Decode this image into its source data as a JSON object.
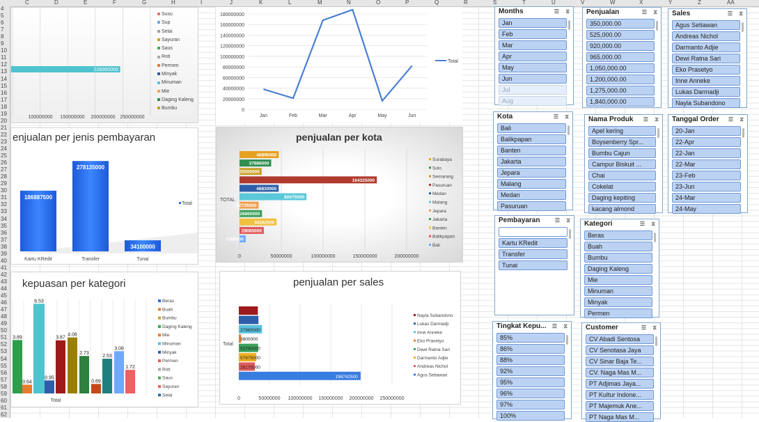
{
  "sheet": {
    "columns": [
      "C",
      "D",
      "E",
      "F",
      "G",
      "H",
      "I",
      "J",
      "K",
      "L",
      "M",
      "N",
      "O",
      "P",
      "Q",
      "R",
      "S",
      "T",
      "U",
      "V",
      "W",
      "X",
      "Y",
      "Z",
      "AA"
    ],
    "rows": [
      "4",
      "5",
      "6",
      "7",
      "8",
      "9",
      "10",
      "11",
      "12",
      "13",
      "14",
      "15",
      "16",
      "17",
      "18",
      "19",
      "20",
      "21",
      "22",
      "23",
      "24",
      "25",
      "26",
      "27",
      "28",
      "29",
      "30",
      "31",
      "32",
      "33",
      "34",
      "35",
      "36",
      "37",
      "38",
      "39",
      "40",
      "41",
      "42",
      "43",
      "44",
      "45",
      "46",
      "47",
      "48",
      "49",
      "50",
      "51",
      "52",
      "53",
      "54",
      "55",
      "56",
      "57",
      "58",
      "59",
      "60",
      "61",
      "62"
    ]
  },
  "chart_data": [
    {
      "type": "bar",
      "title": "",
      "legend": [
        "Susu",
        "Sup",
        "Selai",
        "Sayuran",
        "Saus",
        "Roti",
        "Permen",
        "Minyak",
        "Minuman",
        "Mie",
        "Daging Kaleng",
        "Bumbu"
      ],
      "series": [
        {
          "values": [
            228360000
          ]
        }
      ],
      "x_ticks": [
        "100000000",
        "150000000",
        "200000000",
        "250000000"
      ],
      "colors": [
        "#e8756a",
        "#6fa8dc",
        "#a0a0a0",
        "#c9a227",
        "#4aa85a",
        "#aaaaaa",
        "#e87c2e",
        "#2e5ea8",
        "#5bc0de",
        "#f0a050",
        "#2f8f4f",
        "#c9a227"
      ]
    },
    {
      "type": "line",
      "title": "",
      "categories": [
        "Jan",
        "Feb",
        "Mar",
        "Apr",
        "May",
        "Jun"
      ],
      "series": [
        {
          "name": "Total",
          "values": [
            38000000,
            21000000,
            168000000,
            188000000,
            16000000,
            82000000
          ]
        }
      ],
      "y_ticks": [
        "0",
        "20000000",
        "40000000",
        "60000000",
        "80000000",
        "100000000",
        "120000000",
        "140000000",
        "160000000",
        "180000000"
      ],
      "ylim": [
        0,
        180000000
      ],
      "color": "#4a7fd4"
    },
    {
      "type": "bar",
      "title": "enjualan per jenis pembayaran",
      "categories": [
        "Kartu KRedit",
        "Transfer",
        "Tunai"
      ],
      "series": [
        {
          "name": "Total",
          "values": [
            186887500,
            278135000,
            34100000
          ]
        }
      ],
      "value_labels": [
        "186887500",
        "278135000",
        "34100000"
      ],
      "color": "#2d6fe6"
    },
    {
      "type": "bar",
      "title": "penjualan per kota",
      "categories": [
        "Surabaya",
        "Solo",
        "Semarang",
        "Pasuruan",
        "Medan",
        "Malang",
        "Jepara",
        "Jakarta",
        "Banten",
        "Balikpapan",
        "Bali"
      ],
      "values": [
        46890000,
        37886000,
        26500000,
        164325000,
        46830000,
        80075000,
        22726000,
        26860000,
        44262500,
        29065000,
        7386000
      ],
      "value_labels": [
        "46890000",
        "37886000",
        "26500000",
        "164325000",
        "46830000",
        "80075000",
        "22726000",
        "26860000",
        "44262500",
        "29065000",
        "7386000"
      ],
      "axis_label": "TOTAL",
      "x_ticks": [
        "0",
        "50000000",
        "100000000",
        "150000000",
        "200000000"
      ],
      "xlim": [
        0,
        200000000
      ],
      "colors": [
        "#e8a020",
        "#2f8f4f",
        "#c9a227",
        "#b03a2e",
        "#2e5ea8",
        "#5bc8d8",
        "#f0a050",
        "#3aa05a",
        "#f0c040",
        "#e05a5a",
        "#6fa8ff"
      ]
    },
    {
      "type": "bar",
      "title": "kepuasan per kategori",
      "axis_label": "Total",
      "legend": [
        "Beras",
        "Buah",
        "Bumbu",
        "Daging Kaleng",
        "Mie",
        "Minuman",
        "Minyak",
        "Permen",
        "Roti",
        "Saus",
        "Sayuran",
        "Selai"
      ],
      "values": [
        3.89,
        0.64,
        6.53,
        0.95,
        3.87,
        4.08,
        2.73,
        0.69,
        2.53,
        3.08,
        1.72
      ],
      "value_labels": [
        "3.89",
        "0.64",
        "6.53",
        "0.95",
        "3.87",
        "4.08",
        "2.73",
        "0.69",
        "2.53",
        "3.08",
        "1.72"
      ],
      "ylim": [
        0,
        7
      ],
      "colors": [
        "#2e9e4a",
        "#e87c2e",
        "#4fc3d0",
        "#2e5ea8",
        "#9e1a1a",
        "#9a8000",
        "#2f7f3f",
        "#c04a1a",
        "#1f7f7f",
        "#6fa8ff",
        "#f06060"
      ],
      "legend_colors": [
        "#2d6fe6",
        "#e87c2e",
        "#c9a227",
        "#3aa05a",
        "#e87c2e",
        "#5bc0de",
        "#2e5ea8",
        "#e05a5a",
        "#aaaaaa",
        "#4aa85a",
        "#f06060",
        "#2f6fa0"
      ]
    },
    {
      "type": "bar",
      "title": "penjualan per sales",
      "axis_label": "Total",
      "legend": [
        "Nayla Subandono",
        "Lukas Darmadji",
        "Inne Anneke",
        "Eko Prasetyo",
        "Dewi Ratna Sari",
        "Darmanto Adjie",
        "Andreas Nichol",
        "Agus Setiawan"
      ],
      "values": [
        31000000,
        32000000,
        37865000,
        3800000,
        31500000,
        28500000,
        26175000,
        198742500
      ],
      "value_labels": [
        "",
        "",
        "37865000",
        "3800000",
        "63780000",
        "57875000",
        "26175000",
        "198742500"
      ],
      "x_ticks": [
        "0",
        "50000000",
        "100000000",
        "150000000",
        "200000000",
        "250000000"
      ],
      "xlim": [
        0,
        250000000
      ],
      "colors": [
        "#9e1a1a",
        "#2e5ea8",
        "#5bc0de",
        "#e87c2e",
        "#3aa05a",
        "#f0b020",
        "#e05a5a",
        "#3a7de0"
      ]
    }
  ],
  "slicers": {
    "months": {
      "title": "Months",
      "items": [
        "Jan",
        "Feb",
        "Mar",
        "Apr",
        "May",
        "Jun",
        "Jul",
        "Aug"
      ]
    },
    "penjualan": {
      "title": "Penjualan",
      "items": [
        "350,000.00",
        "525,000.00",
        "920,000.00",
        "965,000.00",
        "1,050,000.00",
        "1,200,000.00",
        "1,275,000.00",
        "1,840,000.00"
      ]
    },
    "sales": {
      "title": "Sales",
      "items": [
        "Agus Setiawan",
        "Andreas Nichol",
        "Darmanto Adjie",
        "Dewi Ratna Sari",
        "Eko Prasetyo",
        "Inne Anneke",
        "Lukas Darmadji",
        "Nayla Subandono"
      ]
    },
    "kota": {
      "title": "Kota",
      "items": [
        "Bali",
        "Balikpapan",
        "Banten",
        "Jakarta",
        "Jepara",
        "Malang",
        "Medan",
        "Pasuruan"
      ]
    },
    "nama_produk": {
      "title": "Nama Produk",
      "items": [
        "Apel kering",
        "Boysenberry Spr...",
        "Bumbu Cajun",
        "Campur Biskuit ...",
        "Chai",
        "Cokelat",
        "Daging kepiting",
        "kacang almond"
      ]
    },
    "tanggal_order": {
      "title": "Tanggal Order",
      "items": [
        "20-Jan",
        "22-Apr",
        "22-Jan",
        "22-Mar",
        "23-Feb",
        "23-Jun",
        "24-Mar",
        "24-May"
      ]
    },
    "pembayaran": {
      "title": "Pembayaran",
      "items": [
        "",
        "Kartu KRedit",
        "Transfer",
        "Tunai"
      ]
    },
    "kategori": {
      "title": "Kategori",
      "items": [
        "Beras",
        "Buah",
        "Bumbu",
        "Daging Kaleng",
        "Mie",
        "Minuman",
        "Minyak",
        "Permen"
      ]
    },
    "tingkat": {
      "title": "Tingkat Kepu...",
      "items": [
        "85%",
        "86%",
        "88%",
        "92%",
        "95%",
        "96%",
        "97%",
        "100%"
      ]
    },
    "customer": {
      "title": "Customer",
      "items": [
        "CV Abadi Sentosa",
        "CV Senotasa Jaya",
        "CV Sinar Baja Te...",
        "CV. Naga Mas M...",
        "PT Adjimas Jaya...",
        "PT Kultur Indone...",
        "PT Majemuk Ane...",
        "PT Naga Mas M..."
      ]
    }
  }
}
